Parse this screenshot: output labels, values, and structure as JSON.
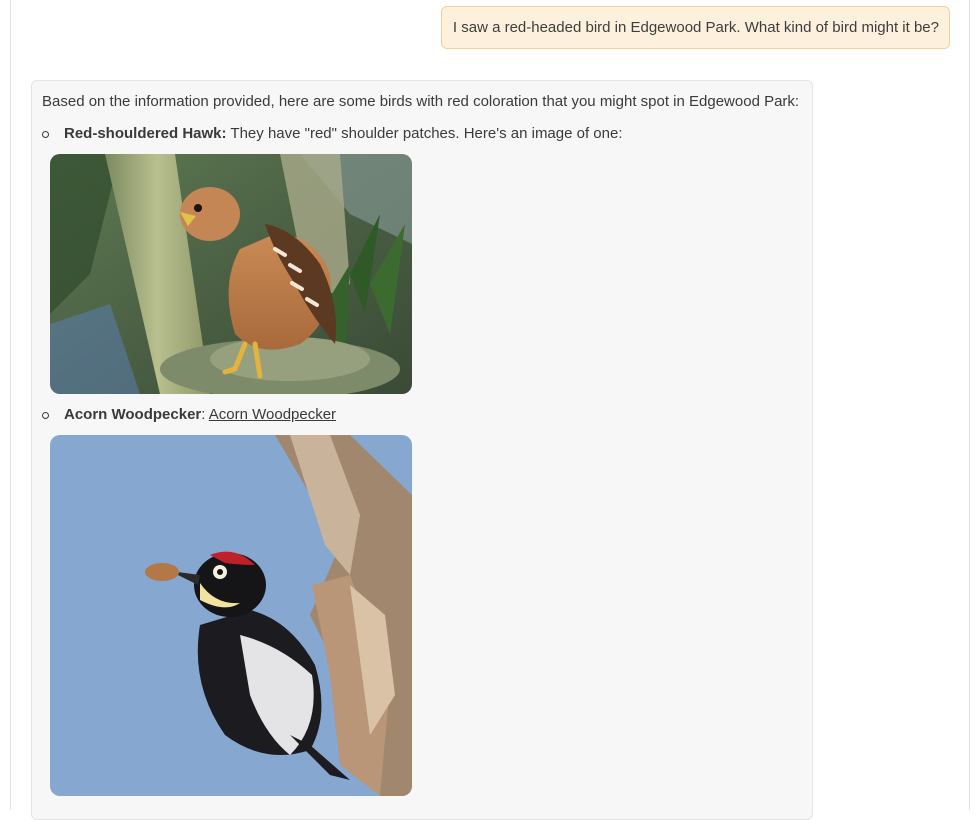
{
  "user_message": "I saw a red-headed bird in Edgewood Park. What kind of bird might it be?",
  "assistant": {
    "intro": "Based on the information provided, here are some birds with red coloration that you might spot in Edgewood Park:",
    "birds": [
      {
        "name": "Red-shouldered Hawk:",
        "description": " They have \"red\" shoulder patches. Here's an image of one:",
        "image_icon": "hawk-photo"
      },
      {
        "name": "Acorn Woodpecker",
        "separator": ": ",
        "link_text": "Acorn Woodpecker",
        "image_icon": "woodpecker-photo"
      }
    ]
  },
  "colors": {
    "user_bubble_bg": "#fdf1de",
    "user_bubble_border": "#f3cf9d",
    "assistant_bubble_bg": "#f7f7f7",
    "text": "#3a3a3a"
  }
}
